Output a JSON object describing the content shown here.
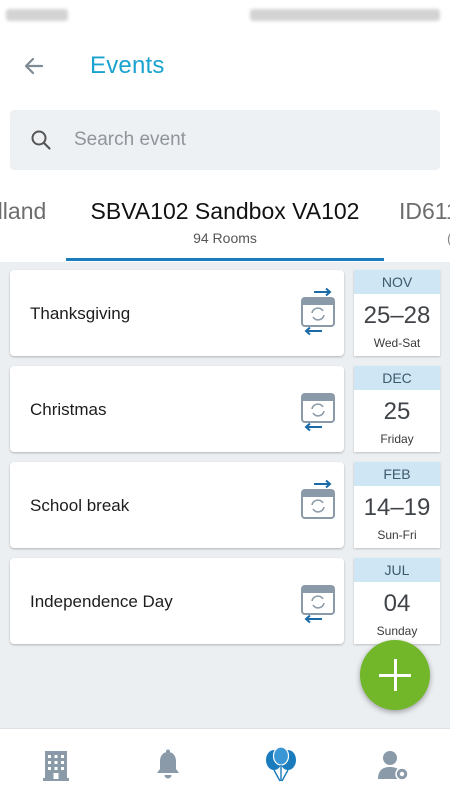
{
  "header": {
    "title": "Events"
  },
  "search": {
    "placeholder": "Search event"
  },
  "tabs": [
    {
      "name": "dland",
      "subtitle": ""
    },
    {
      "name": "SBVA102 Sandbox VA102",
      "subtitle": "94 Rooms"
    },
    {
      "name": "ID611",
      "subtitle": "("
    }
  ],
  "events": [
    {
      "name": "Thanksgiving",
      "month": "NOV",
      "days": "25–28",
      "weekdays": "Wed-Sat",
      "icon": "calendar-sync-icon"
    },
    {
      "name": "Christmas",
      "month": "DEC",
      "days": "25",
      "weekdays": "Friday",
      "icon": "calendar-sync-icon"
    },
    {
      "name": "School break",
      "month": "FEB",
      "days": "14–19",
      "weekdays": "Sun-Fri",
      "icon": "calendar-sync-icon"
    },
    {
      "name": "Independence Day",
      "month": "JUL",
      "days": "04",
      "weekdays": "Sunday",
      "icon": "calendar-sync-icon"
    }
  ],
  "bottom_nav": [
    "building-icon",
    "bell-icon",
    "balloons-icon",
    "user-settings-icon"
  ],
  "colors": {
    "accent": "#1aa3cf",
    "tab_indicator": "#1b7cbd",
    "fab": "#72b62a",
    "month_band": "#cfe6f4",
    "nav_inactive": "#8a9aa8",
    "nav_active": "#1b7cbd"
  }
}
